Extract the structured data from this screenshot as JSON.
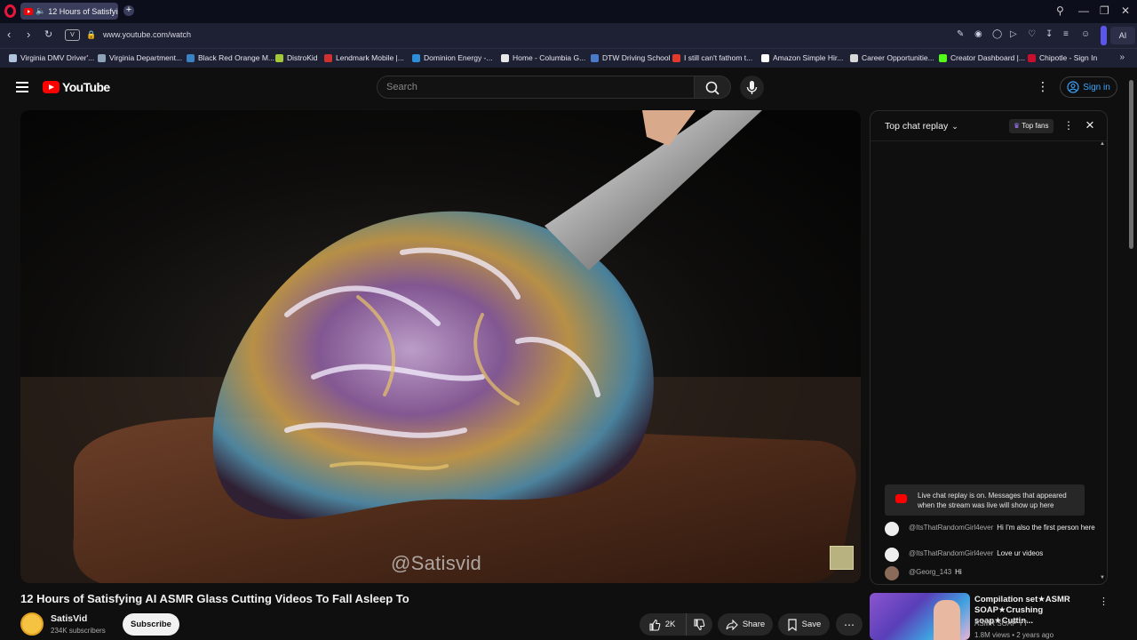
{
  "browser": {
    "tab_title": "12 Hours of Satisfying",
    "new_tab": "+",
    "url": "www.youtube.com/watch",
    "vpn_label": "V",
    "ai_label": "AI",
    "bookmarks": [
      {
        "label": "Virginia DMV Driver'...",
        "color": "#b0c4de"
      },
      {
        "label": "Virginia Department...",
        "color": "#8fa3b8"
      },
      {
        "label": "Black Red Orange M...",
        "color": "#3b82c4"
      },
      {
        "label": "DistroKid",
        "color": "#a3c93a"
      },
      {
        "label": "Lendmark Mobile |...",
        "color": "#d03030"
      },
      {
        "label": "Dominion Energy -...",
        "color": "#2d8fd8"
      },
      {
        "label": "Home - Columbia G...",
        "color": "#e8e8e8"
      },
      {
        "label": "DTW Driving School",
        "color": "#4a7bc8"
      },
      {
        "label": "I still can't fathom t...",
        "color": "#e23a2a"
      },
      {
        "label": "Amazon Simple Hir...",
        "color": "#ffffff"
      },
      {
        "label": "Career Opportunitie...",
        "color": "#d8d8d8"
      },
      {
        "label": "Creator Dashboard |...",
        "color": "#53fc18"
      },
      {
        "label": "Chipotle - Sign In",
        "color": "#c8102e"
      }
    ]
  },
  "youtube": {
    "logo_text": "YouTube",
    "search_placeholder": "Search",
    "sign_in": "Sign in"
  },
  "video": {
    "title": "12 Hours of Satisfying AI ASMR Glass Cutting Videos To Fall Asleep To",
    "watermark": "@Satisvid",
    "channel_name": "SatisVid",
    "subscribers": "234K subscribers",
    "subscribe_label": "Subscribe",
    "likes": "2K",
    "share_label": "Share",
    "save_label": "Save"
  },
  "chat": {
    "title": "Top chat replay",
    "top_fans_label": "Top fans",
    "replay_notice": "Live chat replay is on. Messages that appeared when the stream was live will show up here",
    "messages": [
      {
        "author": "@ItsThatRandomGirl4ever",
        "text": "Hi I'm also the first person here"
      },
      {
        "author": "@ItsThatRandomGirl4ever",
        "text": "Love ur videos"
      },
      {
        "author": "@Georg_143",
        "text": "Hi"
      }
    ]
  },
  "related": {
    "title": "Compilation set★ASMR SOAP★Crushing soap★Cuttin...",
    "channel": "ASMR SOAP YT",
    "meta": "1.8M views • 2 years ago"
  }
}
